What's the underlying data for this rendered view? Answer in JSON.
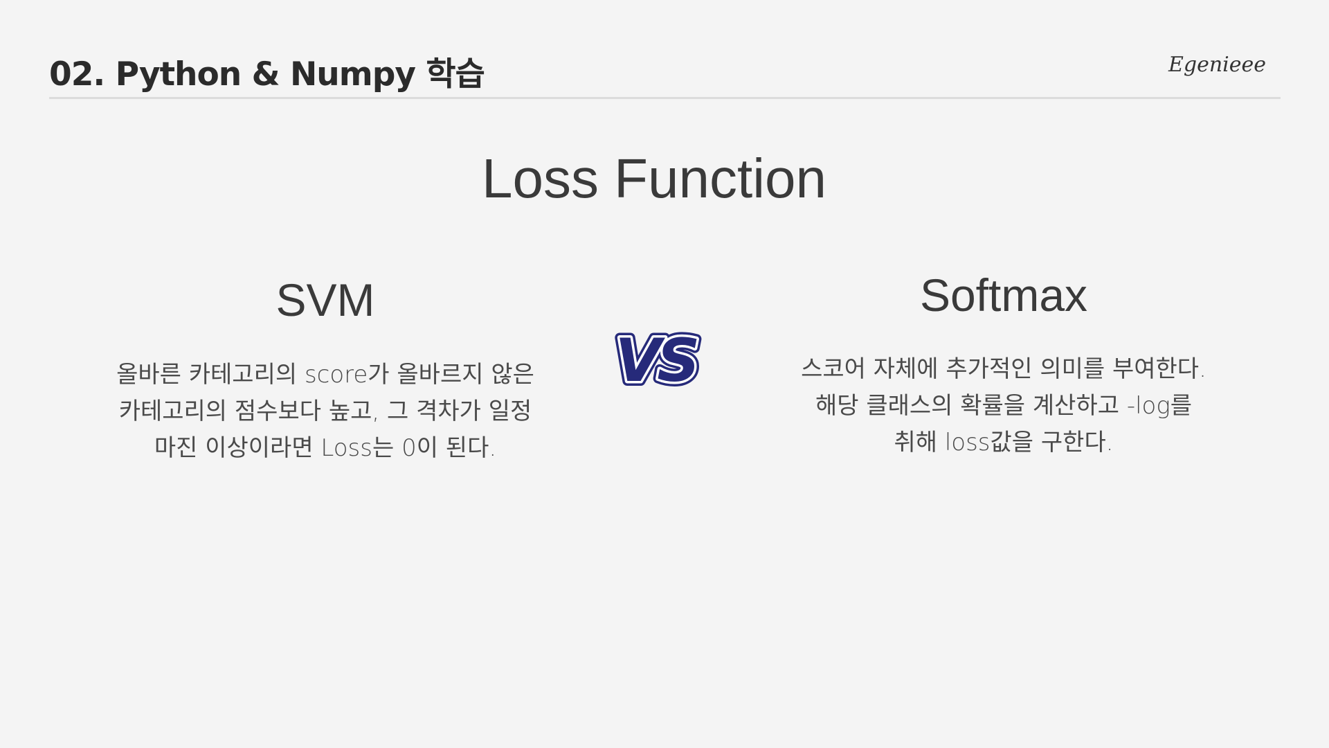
{
  "header": {
    "title": "02. Python & Numpy 학습",
    "brand": "Egenieee"
  },
  "main": {
    "title": "Loss Function"
  },
  "left": {
    "heading": "SVM",
    "lines": [
      "올바른 카테고리의 score가 올바르지 않은",
      "카테고리의 점수보다 높고, 그 격차가 일정",
      "마진 이상이라면 Loss는 0이 된다."
    ]
  },
  "vs": {
    "label": "VS",
    "fill_color": "#262a7a",
    "outline_color": "#ffffff",
    "border_color": "#262a7a"
  },
  "right": {
    "heading": "Softmax",
    "lines": [
      "스코어 자체에 추가적인 의미를 부여한다.",
      "해당 클래스의 확률을 계산하고 -log를",
      "취해 loss값을 구한다."
    ]
  }
}
